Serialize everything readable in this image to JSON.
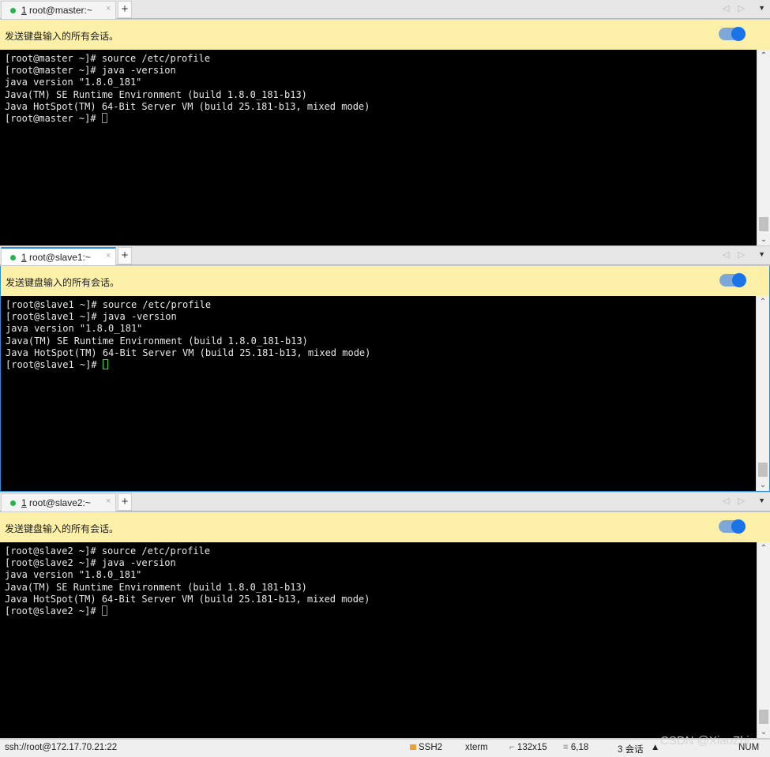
{
  "broadcast_label": "发送键盘输入的所有会话。",
  "tab_add_label": "+",
  "tab_close_label": "×",
  "nav_arrows": "◁ ▷",
  "menu_arrow": "▼",
  "scroll_up": "⌃",
  "scroll_down": "⌄",
  "panes": [
    {
      "tab_number": "1",
      "tab_title": "root@master:~",
      "lines": [
        "[root@master ~]# source /etc/profile",
        "[root@master ~]# java -version",
        "java version \"1.8.0_181\"",
        "Java(TM) SE Runtime Environment (build 1.8.0_181-b13)",
        "Java HotSpot(TM) 64-Bit Server VM (build 25.181-b13, mixed mode)",
        "[root@master ~]# "
      ]
    },
    {
      "tab_number": "1",
      "tab_title": "root@slave1:~",
      "lines": [
        "[root@slave1 ~]# source /etc/profile",
        "[root@slave1 ~]# java -version",
        "java version \"1.8.0_181\"",
        "Java(TM) SE Runtime Environment (build 1.8.0_181-b13)",
        "Java HotSpot(TM) 64-Bit Server VM (build 25.181-b13, mixed mode)",
        "[root@slave1 ~]# "
      ]
    },
    {
      "tab_number": "1",
      "tab_title": "root@slave2:~",
      "lines": [
        "[root@slave2 ~]# source /etc/profile",
        "[root@slave2 ~]# java -version",
        "java version \"1.8.0_181\"",
        "Java(TM) SE Runtime Environment (build 1.8.0_181-b13)",
        "Java HotSpot(TM) 64-Bit Server VM (build 25.181-b13, mixed mode)",
        "[root@slave2 ~]# "
      ]
    }
  ],
  "status": {
    "connection": "ssh://root@172.17.70.21:22",
    "protocol": "SSH2",
    "terminal_type": "xterm",
    "size": "132x15",
    "cursor_pos": "6,18",
    "sessions": "3 会话",
    "num": "NUM"
  },
  "watermark": "CSDN @XiaoZhi"
}
